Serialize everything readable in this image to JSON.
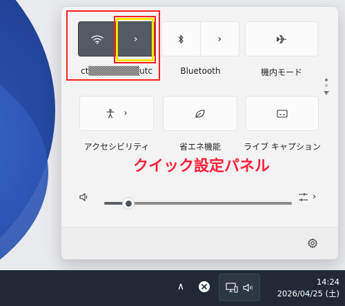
{
  "quick_settings": {
    "wifi": {
      "label": "ct▒▒▒▒▒▒▒▒utc",
      "icon": "wifi-icon",
      "expand": "›",
      "state": "on"
    },
    "bluetooth": {
      "label": "Bluetooth",
      "icon": "bluetooth-icon",
      "expand": "›"
    },
    "airplane": {
      "label": "機内モード",
      "icon": "airplane-icon"
    },
    "accessibility": {
      "label": "アクセシビリティ",
      "icon": "accessibility-icon",
      "expand": "›"
    },
    "energy_saver": {
      "label": "省エネ機能",
      "icon": "leaf-icon"
    },
    "live_captions": {
      "label": "ライブ キャプション",
      "icon": "captions-icon"
    },
    "volume": {
      "icon": "speaker-icon",
      "level_fraction": 0.13,
      "output_icon": "sound-output-icon",
      "expand": "›"
    },
    "settings_icon": "gear-icon"
  },
  "annotation": {
    "text": "クイック設定パネル",
    "color": "#ff1f3a"
  },
  "taskbar": {
    "chevron": "∧",
    "notification_icon": "close-circle-icon",
    "network_icon": "network-icon",
    "volume_icon": "speaker-icon",
    "time": "14:24",
    "date": "2026/04/25 (土)"
  },
  "colors": {
    "active_tile": "#545a63",
    "taskbar": "#1f2a36",
    "highlight_red": "#ff1d1d",
    "highlight_yellow": "#ffe600"
  }
}
